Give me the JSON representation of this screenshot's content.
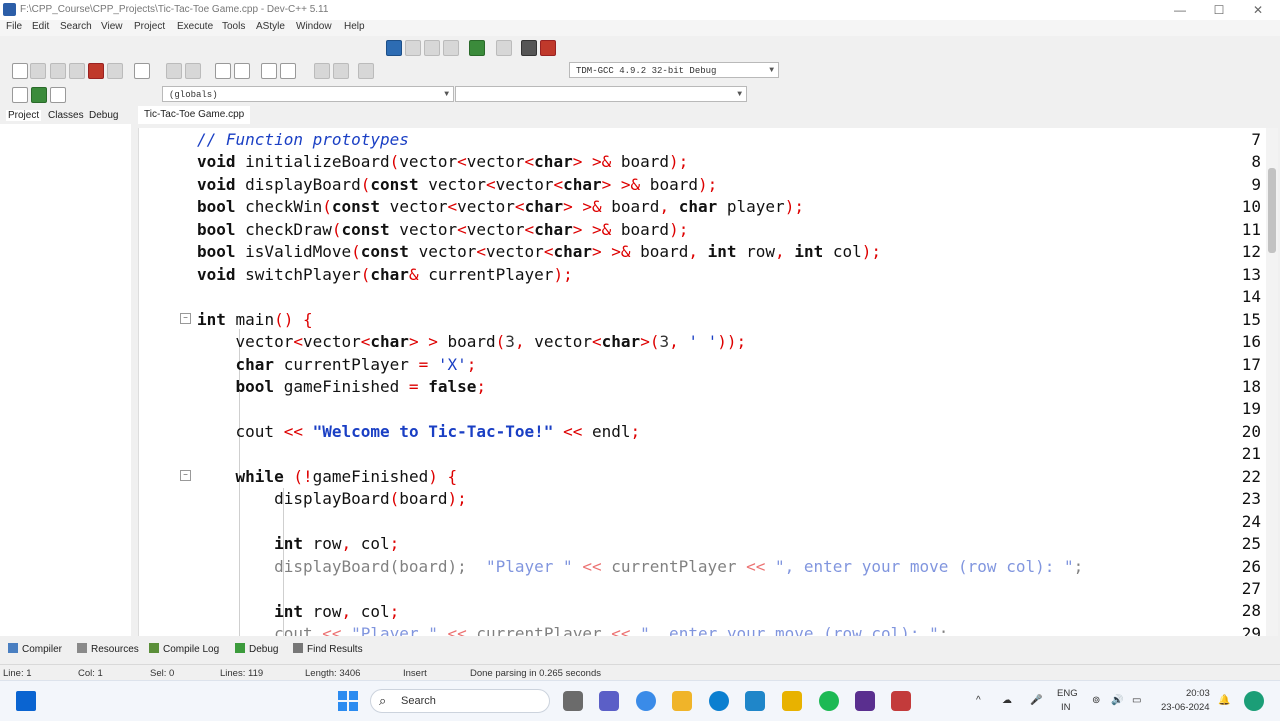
{
  "window": {
    "title": "F:\\CPP_Course\\CPP_Projects\\Tic-Tac-Toe Game.cpp - Dev-C++ 5.11",
    "minimize": "—",
    "maximize": "☐",
    "close": "✕"
  },
  "menu": [
    "File",
    "Edit",
    "Search",
    "View",
    "Project",
    "Execute",
    "Tools",
    "AStyle",
    "Window",
    "Help"
  ],
  "toolbar": {
    "compiler_combo": "TDM-GCC 4.9.2 32-bit Debug",
    "scope_combo": "(globals)",
    "symbol_combo": ""
  },
  "left_tabs": [
    "Project",
    "Classes",
    "Debug"
  ],
  "editor": {
    "file_tab": "Tic-Tac-Toe Game.cpp",
    "line_numbers": [
      "7",
      "8",
      "9",
      "10",
      "11",
      "12",
      "13",
      "14",
      "15",
      "16",
      "17",
      "18",
      "19",
      "20",
      "21",
      "22",
      "23",
      "24",
      "25",
      "26",
      "27",
      "28",
      "29"
    ]
  },
  "bottom_tabs": [
    "Compiler",
    "Resources",
    "Compile Log",
    "Debug",
    "Find Results"
  ],
  "status": {
    "line": "Line:  1",
    "col": "Col:  1",
    "sel": "Sel:  0",
    "lines": "Lines:  119",
    "length": "Length:  3406",
    "mode": "Insert",
    "message": "Done parsing in 0.265 seconds"
  },
  "taskbar": {
    "search_placeholder": "Search",
    "lang_top": "ENG",
    "lang_bottom": "IN",
    "time": "20:03",
    "date": "23-06-2024"
  },
  "colors": {
    "keyword": "#000000",
    "comment": "#1a3fc4",
    "string": "#1a3fc4",
    "symbol": "#d00000",
    "number": "#333333"
  }
}
